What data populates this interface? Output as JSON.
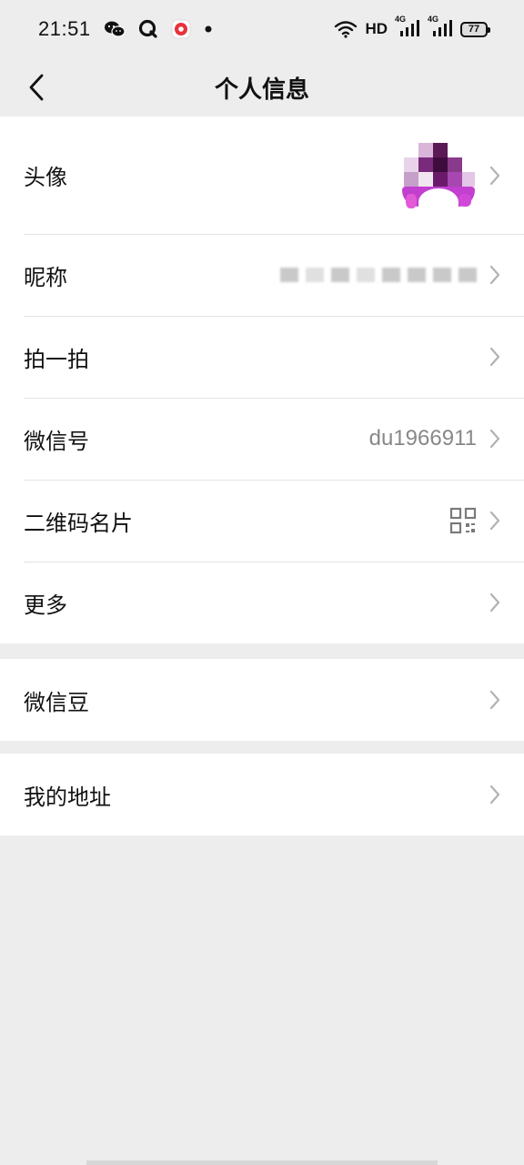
{
  "status_bar": {
    "time": "21:51",
    "network_label": "HD",
    "signal_1_label": "4G",
    "signal_2_label": "4G",
    "battery_level": "77",
    "icons": [
      "wechat-icon",
      "q-app-icon",
      "record-icon",
      "dot-icon",
      "wifi-icon",
      "hd-icon",
      "signal-4g-icon",
      "signal-4g-icon",
      "battery-icon"
    ]
  },
  "header": {
    "title": "个人信息",
    "back_icon": "chevron-left-icon"
  },
  "group_profile": {
    "rows": [
      {
        "label": "头像"
      },
      {
        "label": "昵称",
        "value": "*** ***"
      },
      {
        "label": "拍一拍"
      },
      {
        "label": "微信号",
        "value": "du1966911"
      },
      {
        "label": "二维码名片",
        "value_icon": "qr-code-icon"
      },
      {
        "label": "更多"
      }
    ]
  },
  "group_beans": {
    "rows": [
      {
        "label": "微信豆"
      }
    ]
  },
  "group_address": {
    "rows": [
      {
        "label": "我的地址"
      }
    ]
  },
  "colors": {
    "background": "#ededed",
    "card": "#ffffff",
    "text_primary": "#111111",
    "text_secondary": "#888888",
    "avatar_accent": "#c23fd0"
  }
}
